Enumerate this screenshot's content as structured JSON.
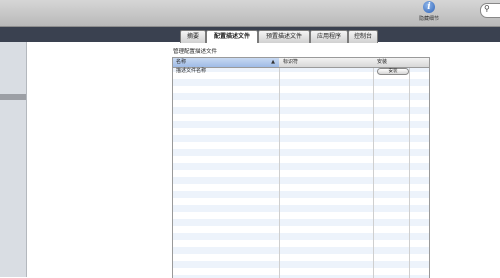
{
  "toolbar": {
    "info_label": "隐藏细节"
  },
  "tabs": [
    {
      "label": "摘要",
      "active": false
    },
    {
      "label": "配置描述文件",
      "active": true
    },
    {
      "label": "预置描述文件",
      "active": false
    },
    {
      "label": "应用程序",
      "active": false
    },
    {
      "label": "控制台",
      "active": false
    }
  ],
  "main": {
    "section_title": "管理配置描述文件",
    "table": {
      "columns": [
        "名称",
        "标识符",
        "安装"
      ],
      "sorted_column": "名称",
      "sort_direction": "ascending",
      "rows": [
        {
          "name": "描述文件名称",
          "identifier": "",
          "action_label": "安装"
        }
      ]
    }
  },
  "colors": {
    "tab_bar": "#3a4150",
    "row_stripe": "#edf3fb",
    "sorted_header": "#9fbbe6"
  }
}
